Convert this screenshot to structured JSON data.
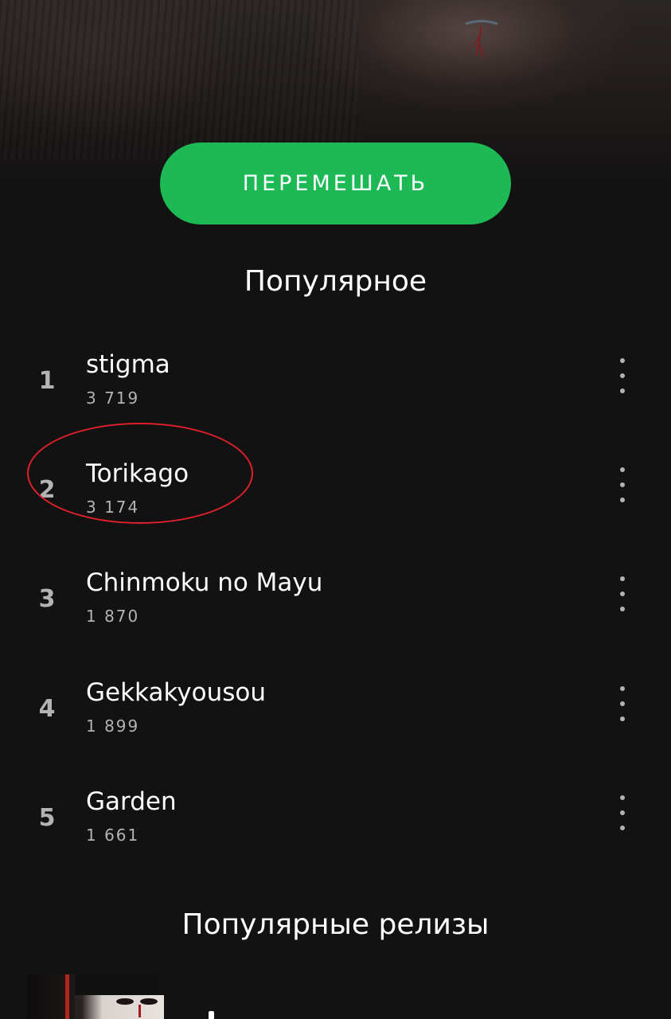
{
  "header": {
    "artwork": "artist-cover-image"
  },
  "actions": {
    "shuffle_label": "ПЕРЕМЕШАТЬ",
    "accent_color": "#1db954"
  },
  "popular": {
    "title": "Популярное",
    "tracks": [
      {
        "rank": "1",
        "title": "stigma",
        "plays": "3 719"
      },
      {
        "rank": "2",
        "title": "Torikago",
        "plays": "3 174"
      },
      {
        "rank": "3",
        "title": "Chinmoku no Mayu",
        "plays": "1 870"
      },
      {
        "rank": "4",
        "title": "Gekkakyousou",
        "plays": "1 899"
      },
      {
        "rank": "5",
        "title": "Garden",
        "plays": "1 661"
      }
    ],
    "more_icon": "more-vertical-icon"
  },
  "annotation": {
    "color": "#e0202a",
    "target_track_rank": "2"
  },
  "releases": {
    "title": "Популярные релизы"
  }
}
